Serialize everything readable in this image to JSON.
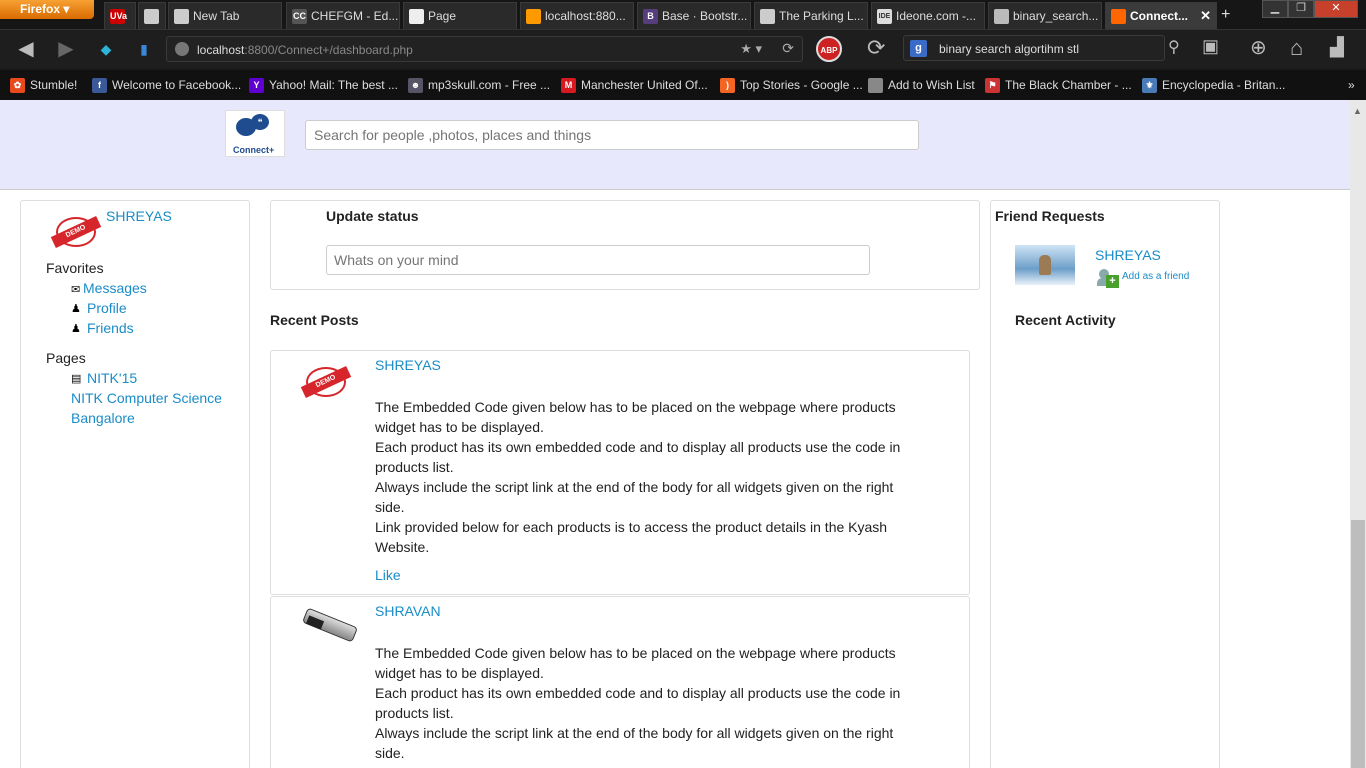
{
  "browser": {
    "menu_label": "Firefox",
    "tabs": [
      {
        "label": "",
        "icon": "UVa"
      },
      {
        "label": "",
        "icon": "page-icon"
      },
      {
        "label": "New Tab",
        "icon": "page-icon"
      },
      {
        "label": "CHEFGM - Ed...",
        "icon": "CC"
      },
      {
        "label": "Page",
        "icon": "page-icon"
      },
      {
        "label": "localhost:880...",
        "icon": "pma-icon"
      },
      {
        "label": "Base · Bootstr...",
        "icon": "B"
      },
      {
        "label": "The Parking L...",
        "icon": "page-icon"
      },
      {
        "label": "Ideone.com -...",
        "icon": "IDE"
      },
      {
        "label": "binary_search...",
        "icon": "gamepad-icon"
      },
      {
        "label": "Connect...",
        "icon": "xampp-icon",
        "active": true
      }
    ],
    "new_tab_label": "+",
    "url_host": "localhost",
    "url_path": ":8800/Connect+/dashboard.php",
    "search_text": "binary search algortihm stl",
    "abp_label": "ABP",
    "bookmarks": [
      {
        "label": "Stumble!",
        "color": "#e8491d"
      },
      {
        "label": "Welcome to Facebook...",
        "color": "#3b5998"
      },
      {
        "label": "Yahoo! Mail: The best ...",
        "color": "#5f01d1"
      },
      {
        "label": "mp3skull.com - Free ...",
        "color": "#556"
      },
      {
        "label": "Manchester United Of...",
        "color": "#d71920"
      },
      {
        "label": "Top Stories - Google ...",
        "color": "#f26522"
      },
      {
        "label": "Add to Wish List",
        "color": "#888"
      },
      {
        "label": "The Black Chamber - ...",
        "color": "#c33"
      },
      {
        "label": "Encyclopedia - Britan...",
        "color": "#4a7bb7"
      }
    ]
  },
  "header": {
    "logo_text": "Connect+",
    "search_placeholder": "Search for people ,photos, places and things"
  },
  "left": {
    "user_name": "SHREYAS",
    "stamp_text": "DEMO",
    "favorites_title": "Favorites",
    "favorites": [
      "Messages",
      "Profile",
      "Friends"
    ],
    "pages_title": "Pages",
    "pages": [
      "NITK'15",
      "NITK Computer Science",
      "Bangalore"
    ]
  },
  "status": {
    "title": "Update status",
    "placeholder": "Whats on your mind"
  },
  "recent_posts_title": "Recent Posts",
  "posts": [
    {
      "author": "SHREYAS",
      "lines": [
        "The Embedded Code given below has to be placed on the webpage where products widget has to be displayed.",
        "Each product has its own embedded code and to display all products use the code in products list.",
        "Always include the script link at the end of the body for all widgets given on the right side.",
        "Link provided below for each products is to access the product details in the Kyash Website."
      ],
      "like": "Like"
    },
    {
      "author": "SHRAVAN",
      "lines": [
        "The Embedded Code given below has to be placed on the webpage where products widget has to be displayed.",
        "Each product has its own embedded code and to display all products use the code in products list.",
        "Always include the script link at the end of the body for all widgets given on the right side."
      ]
    }
  ],
  "right": {
    "friend_requests_title": "Friend Requests",
    "request_name": "SHREYAS",
    "add_label": "Add as a friend",
    "recent_activity_title": "Recent Activity"
  }
}
